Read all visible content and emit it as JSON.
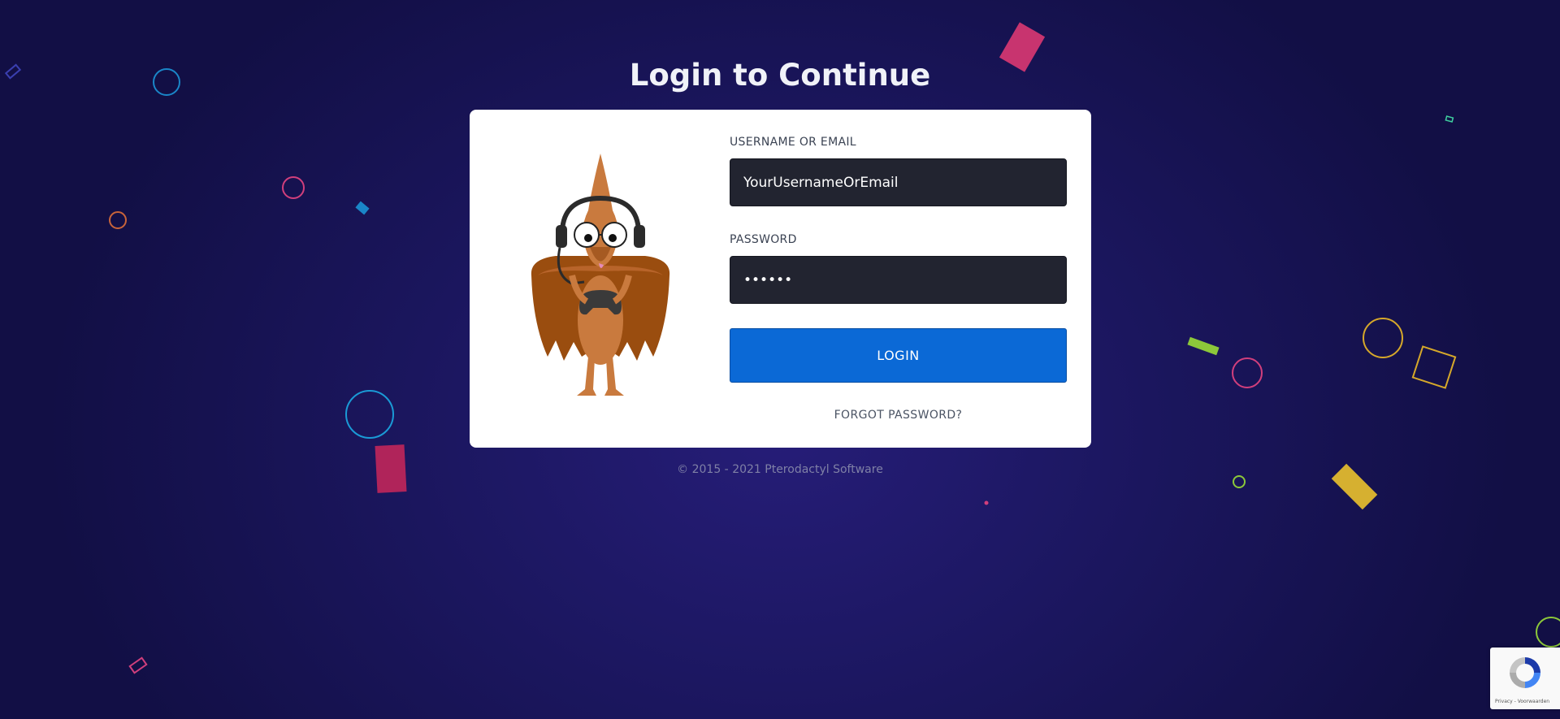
{
  "page": {
    "title": "Login to Continue",
    "footer": "© 2015 - 2021 Pterodactyl Software"
  },
  "form": {
    "username_label": "USERNAME OR EMAIL",
    "username_value": "YourUsernameOrEmail",
    "password_label": "PASSWORD",
    "password_value": "••••••",
    "login_label": "LOGIN",
    "forgot_label": "FORGOT PASSWORD?"
  },
  "recaptcha": {
    "icon": "recaptcha-icon",
    "links": "Privacy - Voorwaarden"
  },
  "colors": {
    "background": "#1c1761",
    "card": "#ffffff",
    "input_bg": "#222430",
    "button": "#0b69d6",
    "title": "#f0f2f8",
    "footer_text": "#7f80a6"
  }
}
